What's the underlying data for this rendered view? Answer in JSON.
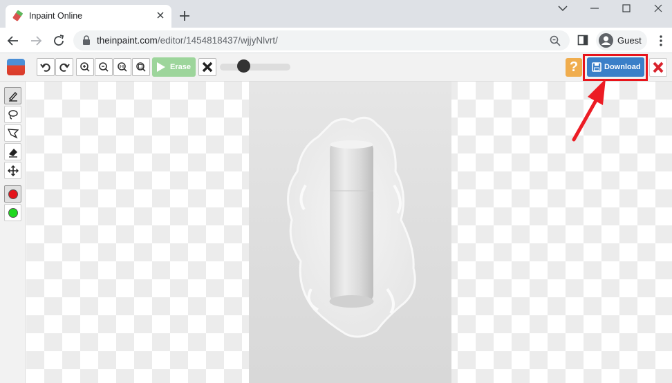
{
  "browser": {
    "tab_title": "Inpaint Online",
    "url_domain": "theinpaint.com",
    "url_path": "/editor/1454818437/wjjyNlvrt/",
    "profile_name": "Guest"
  },
  "toolbar": {
    "erase_label": "Erase",
    "help_label": "?",
    "download_label": "Download",
    "brush_size_level": 0.3
  },
  "tools": {
    "marker": "marker-icon",
    "lasso": "lasso-icon",
    "polygon": "polygon-lasso-icon",
    "eraser": "eraser-icon",
    "move": "move-icon",
    "red_swatch_color": "#e3141b",
    "green_swatch_color": "#1fd81f"
  },
  "colors": {
    "accent_download": "#3a7fc8",
    "highlight": "#e8141b",
    "erase_button": "#9dd59b",
    "help_button": "#f0ad4e"
  }
}
